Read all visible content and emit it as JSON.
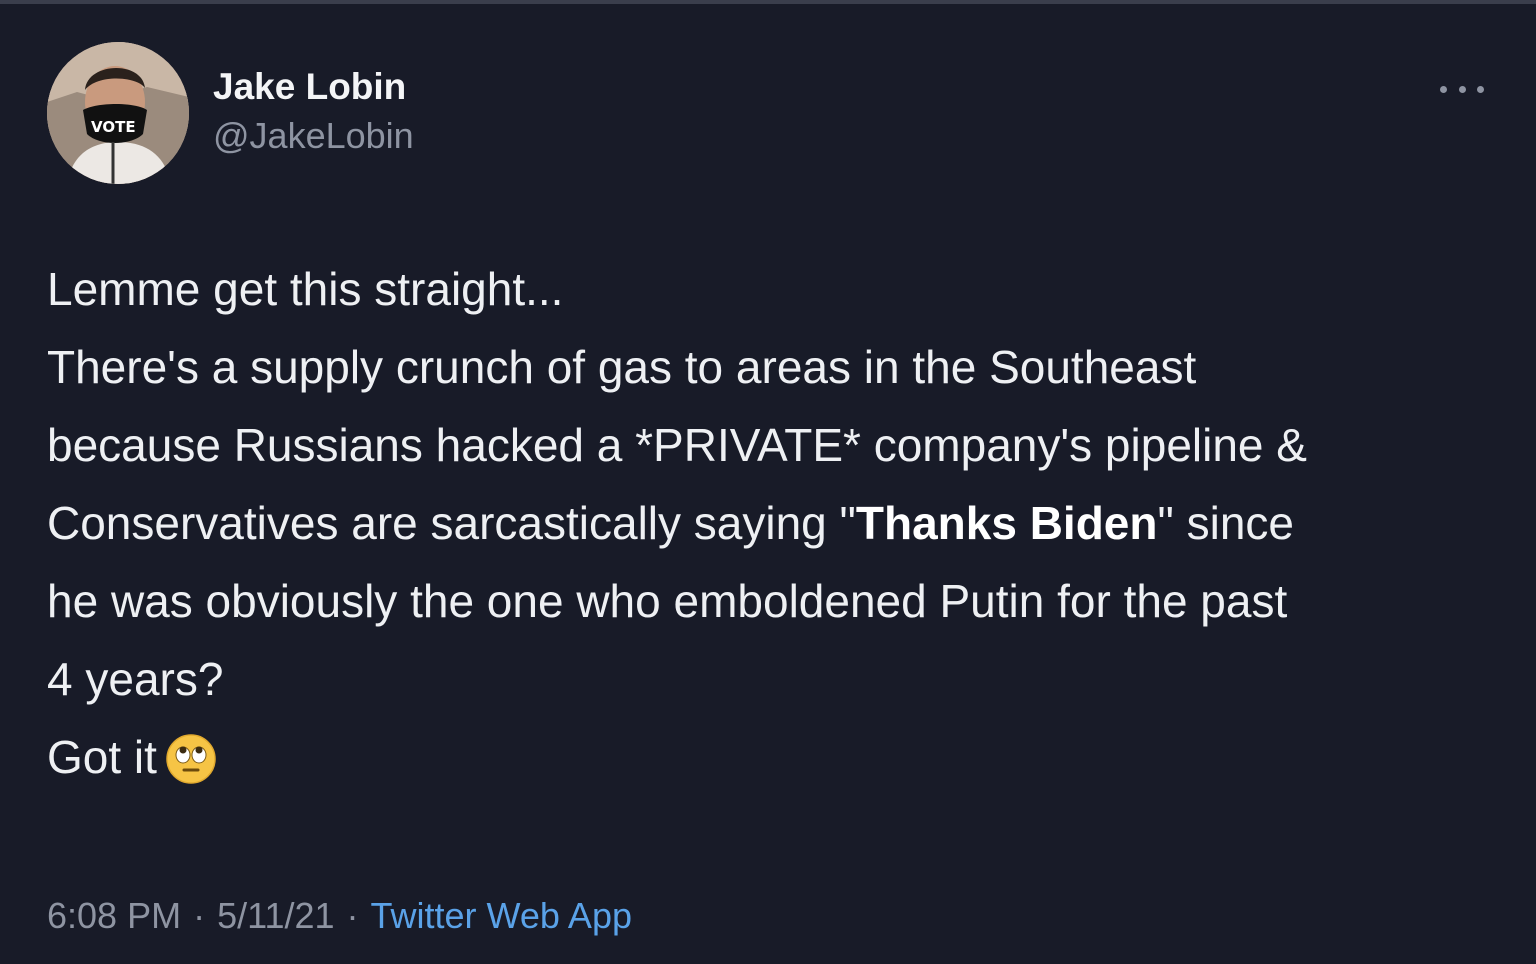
{
  "author": {
    "name": "Jake Lobin",
    "handle": "@JakeLobin",
    "avatar_mask_text": "VOTE"
  },
  "menu_icon": "more-horizontal-icon",
  "tweet": {
    "line1": "Lemme get this straight...",
    "p2_line1": "There's a supply crunch of gas to areas in the Southeast",
    "p2_line2": "because Russians hacked a *PRIVATE* company's pipeline &",
    "p2_line3_before": "Conservatives are sarcastically saying \"",
    "p2_line3_bold": "Thanks Biden",
    "p2_line3_after": "\" since",
    "p2_line4": "he was obviously the one who emboldened Putin for the past",
    "p2_line5": "4 years?",
    "p3": "Got it",
    "emoji": "face-with-rolling-eyes-emoji"
  },
  "meta": {
    "time": "6:08 PM",
    "date": "5/11/21",
    "separator": "·",
    "source": "Twitter Web App"
  },
  "colors": {
    "background": "#181b28",
    "text": "#eef0f3",
    "muted": "#8e94a2",
    "link": "#5aa2e8"
  }
}
